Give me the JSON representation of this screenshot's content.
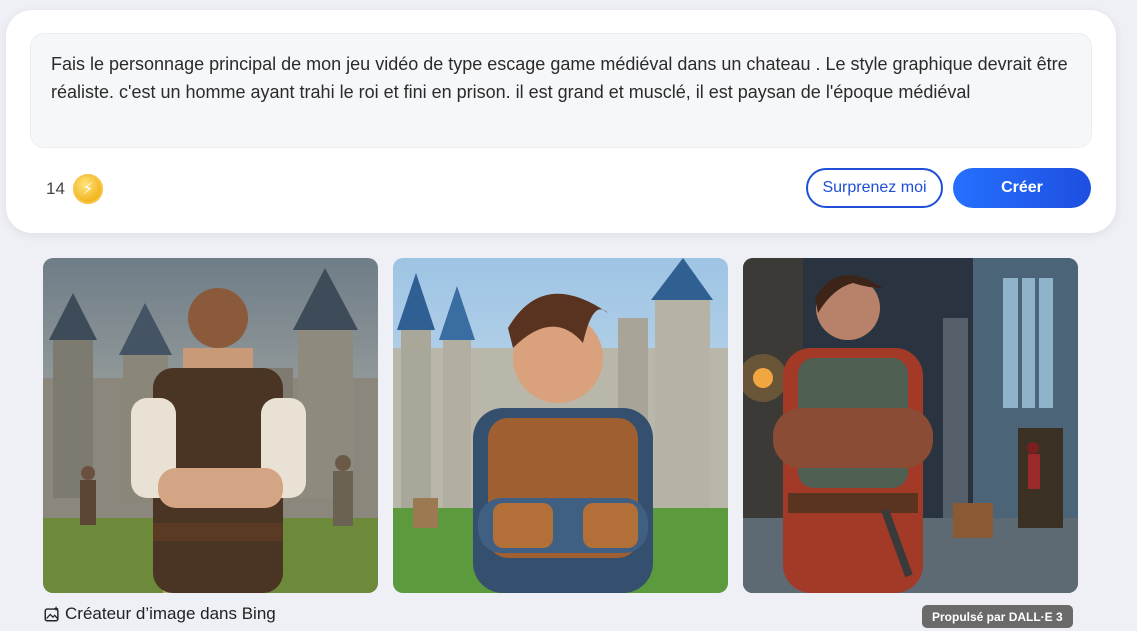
{
  "prompt": {
    "text": "Fais le personnage principal de mon jeu vidéo de type escage game médiéval dans un chateau . Le style graphique devrait être réaliste. c'est un homme ayant trahi le roi et fini en prison. il est grand et musclé, il est paysan de l'époque médiéval"
  },
  "credits": {
    "count": "14",
    "icon": "boost-coin-icon"
  },
  "buttons": {
    "surprise": "Surprenez moi",
    "create": "Créer"
  },
  "images": [
    {
      "icon": "generated-image",
      "subject": "castle-courtyard"
    },
    {
      "icon": "generated-image",
      "subject": "castle-towers"
    },
    {
      "icon": "generated-image",
      "subject": "castle-hall"
    }
  ],
  "footer": {
    "creator_label": "Créateur d’image dans Bing",
    "powered_by": "Propulsé par DALL·E 3"
  },
  "colors": {
    "accent": "#1f4fd6",
    "coin": "#f2b51e",
    "badge": "#6a6a6a"
  }
}
